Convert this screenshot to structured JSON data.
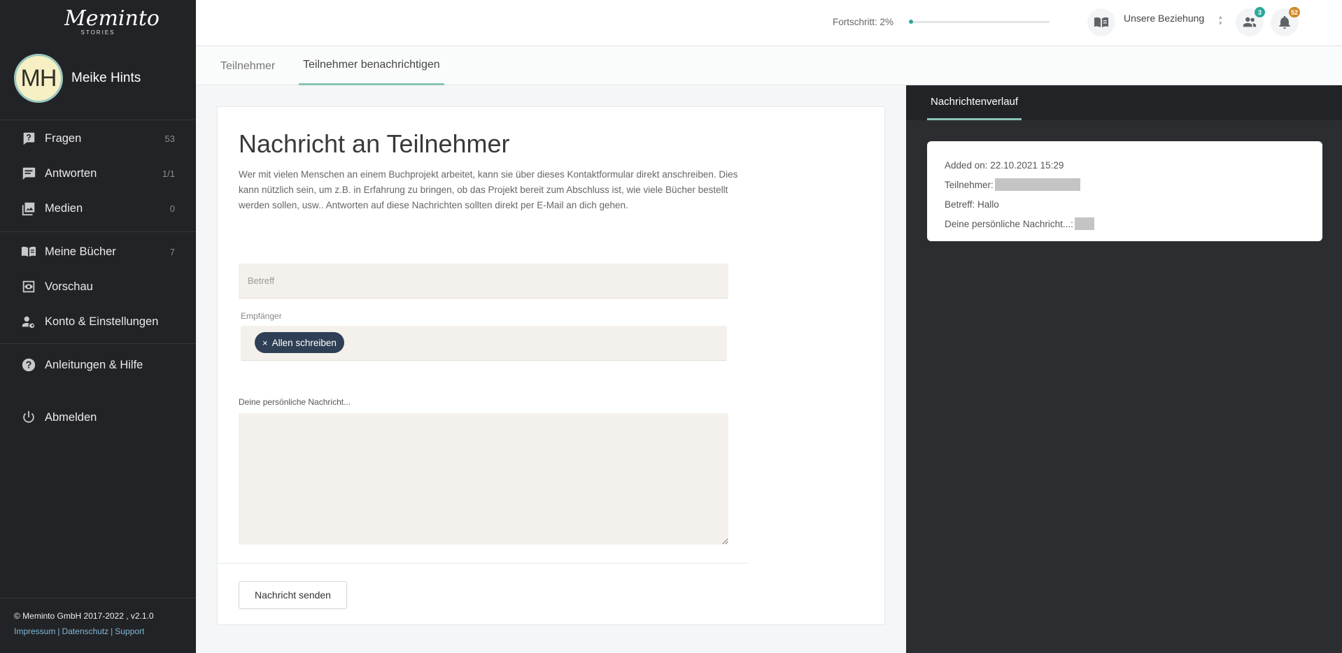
{
  "sidebar": {
    "logo_main": "Meminto",
    "logo_sub": "STORIES",
    "user": {
      "initials": "MH",
      "name": "Meike Hints"
    },
    "items": [
      {
        "label": "Fragen",
        "count": "53",
        "icon": "question-box-icon"
      },
      {
        "label": "Antworten",
        "count": "1/1",
        "icon": "chat-icon"
      },
      {
        "label": "Medien",
        "count": "0",
        "icon": "image-icon"
      },
      {
        "label": "Meine Bücher",
        "count": "7",
        "icon": "book-open-icon"
      },
      {
        "label": "Vorschau",
        "count": "",
        "icon": "eye-icon"
      },
      {
        "label": "Konto & Einstellungen",
        "count": "",
        "icon": "user-settings-icon"
      },
      {
        "label": "Anleitungen & Hilfe",
        "count": "",
        "icon": "help-icon"
      },
      {
        "label": "Abmelden",
        "count": "",
        "icon": "power-icon"
      }
    ],
    "footer": {
      "copyright": "© Meminto GmbH 2017-2022 , v2.1.0",
      "links": [
        "Impressum",
        "Datenschutz",
        "Support"
      ]
    }
  },
  "topbar": {
    "progress_label": "Fortschritt: 2%",
    "progress_value": 0.02,
    "book_name": "Unsere Beziehung",
    "participants_badge": "3",
    "notifications_badge": "52",
    "colors": {
      "accent": "#4bb8a9",
      "participants_badge": "#2fa89a",
      "notifications_badge": "#d08a2c"
    }
  },
  "tabs": [
    {
      "label": "Teilnehmer",
      "active": false
    },
    {
      "label": "Teilnehmer benachrichtigen",
      "active": true
    }
  ],
  "form": {
    "title": "Nachricht an Teilnehmer",
    "description": "Wer mit vielen Menschen an einem Buchprojekt arbeitet, kann sie über dieses Kontaktformular direkt anschreiben. Dies kann nützlich sein, um z.B. in Erfahrung zu bringen, ob das Projekt bereit zum Abschluss ist, wie viele Bücher bestellt werden sollen, usw.. Antworten auf diese Nachrichten sollten direkt per E-Mail an dich gehen.",
    "subject_placeholder": "Betreff",
    "recipients_label": "Empfänger",
    "recipient_chip": "Allen schreiben",
    "message_label": "Deine persönliche Nachricht...",
    "send_button": "Nachricht senden"
  },
  "history": {
    "tab_label": "Nachrichtenverlauf",
    "entry": {
      "added_on": "Added on: 22.10.2021 15:29",
      "participant_label": "Teilnehmer:",
      "subject": "Betreff: Hallo",
      "message_label": "Deine persönliche Nachricht...:"
    }
  }
}
